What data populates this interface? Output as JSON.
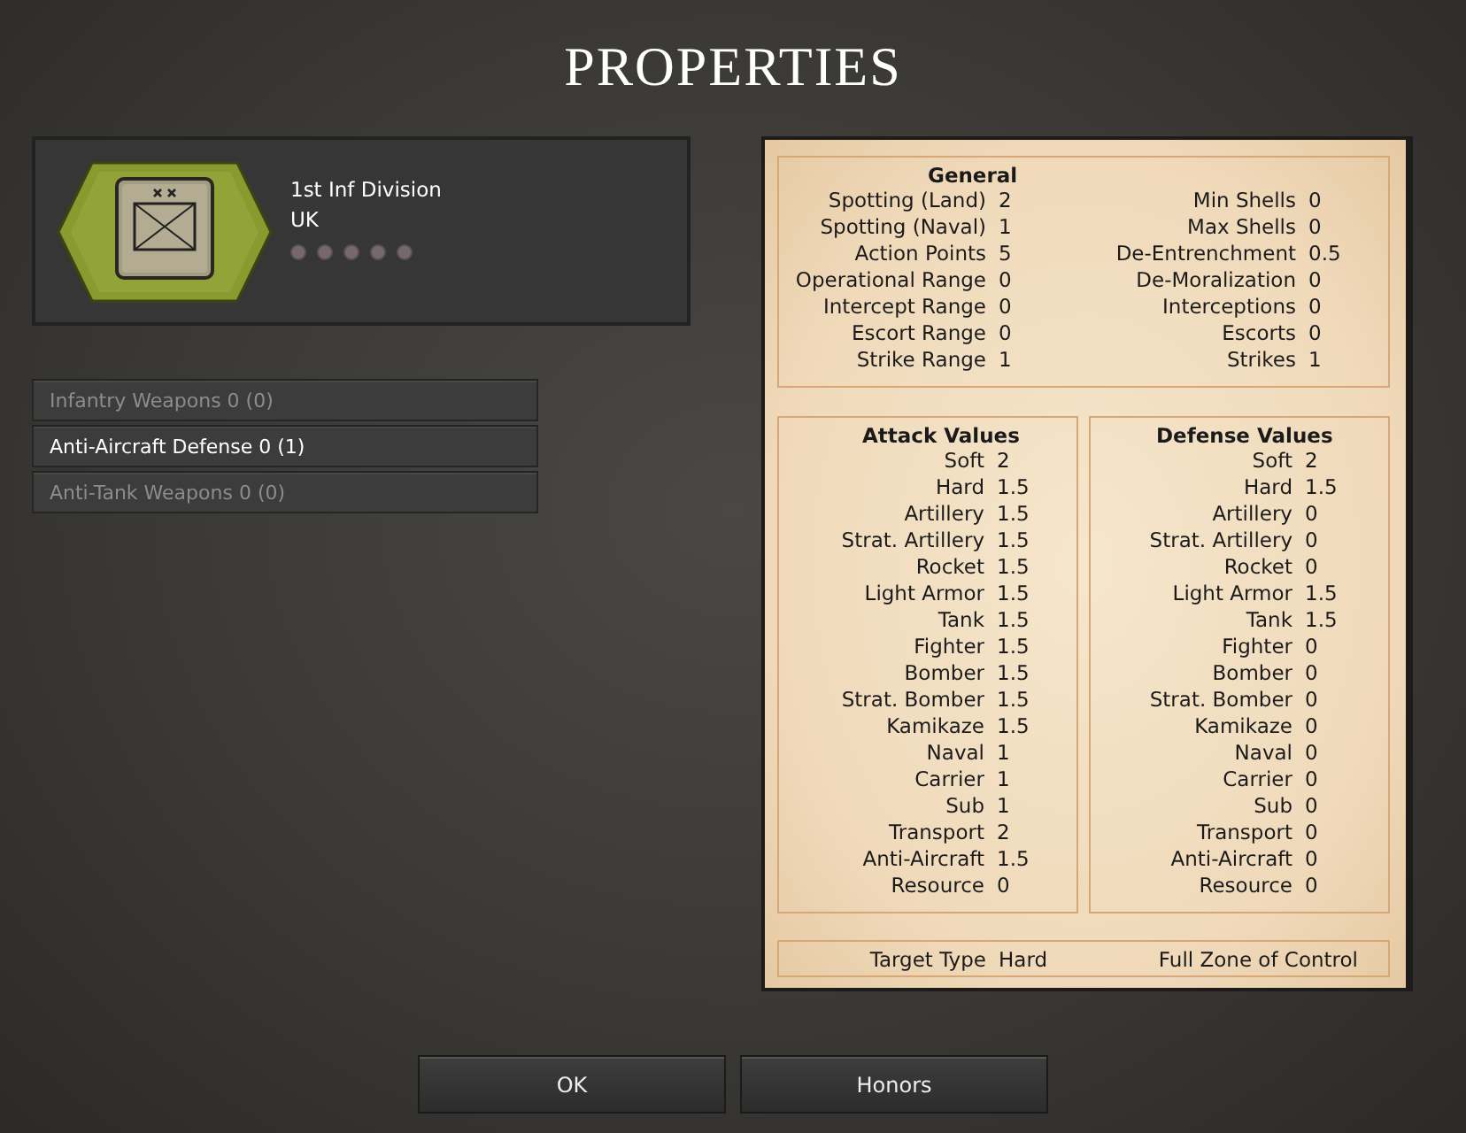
{
  "window": {
    "title": "PROPERTIES"
  },
  "unit": {
    "name": "1st Inf Division",
    "nation": "UK",
    "stars": 0
  },
  "weapons": [
    {
      "label": "Infantry Weapons 0  (0)",
      "selected": false
    },
    {
      "label": "Anti-Aircraft Defense 0  (1)",
      "selected": true
    },
    {
      "label": "Anti-Tank Weapons 0  (0)",
      "selected": false
    }
  ],
  "general": {
    "title": "General",
    "left": [
      {
        "label": "Spotting (Land)",
        "value": "2"
      },
      {
        "label": "Spotting (Naval)",
        "value": "1"
      },
      {
        "label": "Action Points",
        "value": "5"
      },
      {
        "label": "Operational Range",
        "value": "0"
      },
      {
        "label": "Intercept Range",
        "value": "0"
      },
      {
        "label": "Escort Range",
        "value": "0"
      },
      {
        "label": "Strike Range",
        "value": "1"
      }
    ],
    "right": [
      {
        "label": "Min Shells",
        "value": "0"
      },
      {
        "label": "Max Shells",
        "value": "0"
      },
      {
        "label": "De-Entrenchment",
        "value": "0.5"
      },
      {
        "label": "De-Moralization",
        "value": "0"
      },
      {
        "label": "Interceptions",
        "value": "0"
      },
      {
        "label": "Escorts",
        "value": "0"
      },
      {
        "label": "Strikes",
        "value": "1"
      }
    ]
  },
  "attack": {
    "title": "Attack Values",
    "rows": [
      {
        "label": "Soft",
        "value": "2"
      },
      {
        "label": "Hard",
        "value": "1.5"
      },
      {
        "label": "Artillery",
        "value": "1.5"
      },
      {
        "label": "Strat. Artillery",
        "value": "1.5"
      },
      {
        "label": "Rocket",
        "value": "1.5"
      },
      {
        "label": "Light Armor",
        "value": "1.5"
      },
      {
        "label": "Tank",
        "value": "1.5"
      },
      {
        "label": "Fighter",
        "value": "1.5"
      },
      {
        "label": "Bomber",
        "value": "1.5"
      },
      {
        "label": "Strat. Bomber",
        "value": "1.5"
      },
      {
        "label": "Kamikaze",
        "value": "1.5"
      },
      {
        "label": "Naval",
        "value": "1"
      },
      {
        "label": "Carrier",
        "value": "1"
      },
      {
        "label": "Sub",
        "value": "1"
      },
      {
        "label": "Transport",
        "value": "2"
      },
      {
        "label": "Anti-Aircraft",
        "value": "1.5"
      },
      {
        "label": "Resource",
        "value": "0"
      }
    ]
  },
  "defense": {
    "title": "Defense Values",
    "rows": [
      {
        "label": "Soft",
        "value": "2"
      },
      {
        "label": "Hard",
        "value": "1.5"
      },
      {
        "label": "Artillery",
        "value": "0"
      },
      {
        "label": "Strat. Artillery",
        "value": "0"
      },
      {
        "label": "Rocket",
        "value": "0"
      },
      {
        "label": "Light Armor",
        "value": "1.5"
      },
      {
        "label": "Tank",
        "value": "1.5"
      },
      {
        "label": "Fighter",
        "value": "0"
      },
      {
        "label": "Bomber",
        "value": "0"
      },
      {
        "label": "Strat. Bomber",
        "value": "0"
      },
      {
        "label": "Kamikaze",
        "value": "0"
      },
      {
        "label": "Naval",
        "value": "0"
      },
      {
        "label": "Carrier",
        "value": "0"
      },
      {
        "label": "Sub",
        "value": "0"
      },
      {
        "label": "Transport",
        "value": "0"
      },
      {
        "label": "Anti-Aircraft",
        "value": "0"
      },
      {
        "label": "Resource",
        "value": "0"
      }
    ]
  },
  "footer": {
    "label": "Target Type",
    "value": "Hard",
    "zone": "Full Zone of Control"
  },
  "buttons": [
    "OK",
    "Honors"
  ]
}
